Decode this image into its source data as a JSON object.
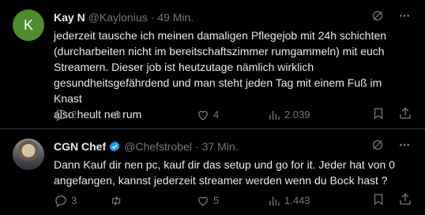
{
  "colors": {
    "background": "#000000",
    "text": "#e7e9ea",
    "muted": "#71767b",
    "divider": "#2f3336",
    "avatar_k": "#4e8c2d",
    "verified": "#1d9bf0"
  },
  "tweets": [
    {
      "avatar_letter": "K",
      "name": "Kay N",
      "handle": "@Kaylonius",
      "dot": "·",
      "time": "49 Min.",
      "text": "jederzeit tausche ich meinen damaligen Pflegejob mit 24h schichten\n(durcharbeiten nicht im bereitschaftszimmer rumgammeln) mit euch\nStreamern. Dieser job ist heutzutage nämlich wirklich\ngesundheitsgefährdend und man steht jeden Tag mit einem Fuß im Knast\nalso heult net rum",
      "replies": "2",
      "retweets": "",
      "likes": "4",
      "views": "2.039",
      "icons": [
        "grok-icon",
        "more-icon",
        "reply-icon",
        "retweet-icon",
        "like-icon",
        "views-icon",
        "bookmark-icon",
        "share-icon"
      ]
    },
    {
      "name": "CGN Chef",
      "handle": "@Chefstrobel",
      "dot": "·",
      "time": "37 Min.",
      "verified": true,
      "text": "Dann Kauf dir nen pc, kauf dir das setup und go for it. Jeder hat von 0\nangefangen, kannst jederzeit streamer werden wenn du Bock hast ?",
      "replies": "3",
      "retweets": "",
      "likes": "5",
      "views": "1.443",
      "icons": [
        "grok-icon",
        "more-icon",
        "reply-icon",
        "retweet-icon",
        "like-icon",
        "views-icon",
        "bookmark-icon",
        "share-icon"
      ]
    }
  ]
}
